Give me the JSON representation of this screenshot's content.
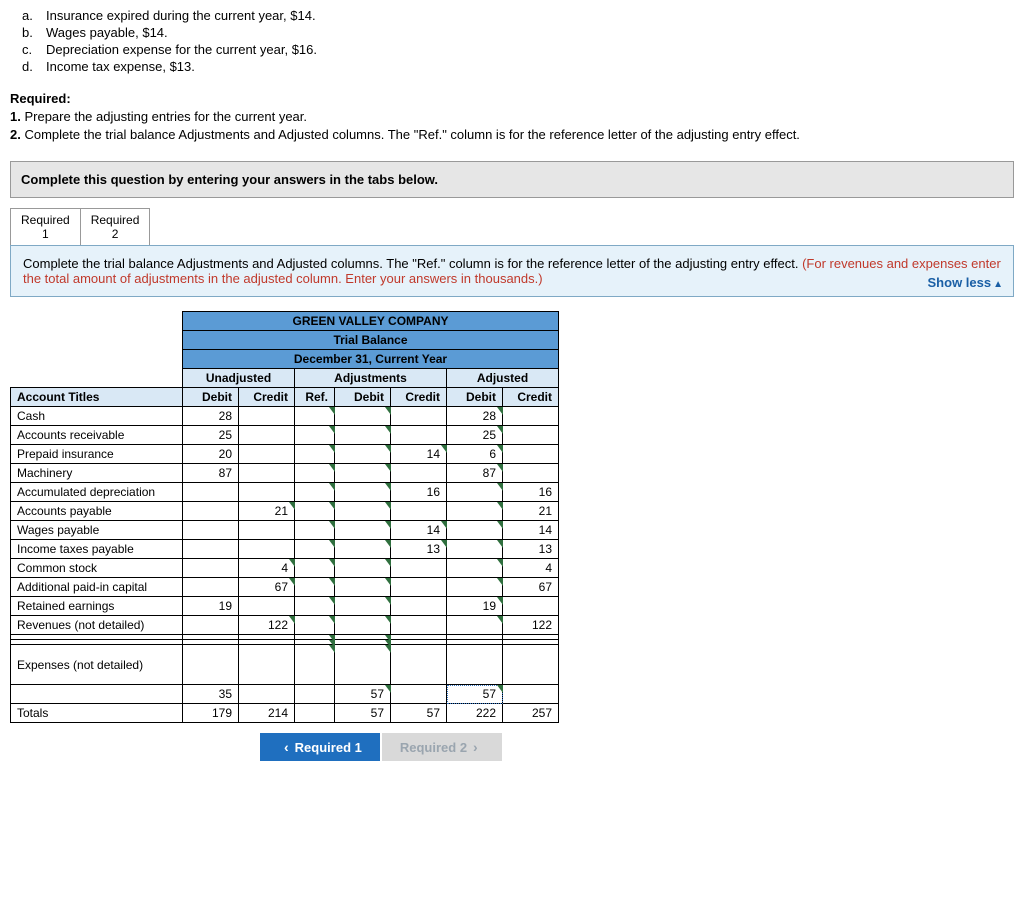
{
  "items": [
    {
      "letter": "a.",
      "text": "Insurance expired during the current year, $14."
    },
    {
      "letter": "b.",
      "text": "Wages payable, $14."
    },
    {
      "letter": "c.",
      "text": "Depreciation expense for the current year, $16."
    },
    {
      "letter": "d.",
      "text": "Income tax expense, $13."
    }
  ],
  "req_label": "Required:",
  "req": [
    {
      "n": "1.",
      "t": "Prepare the adjusting entries for the current year."
    },
    {
      "n": "2.",
      "t": "Complete the trial balance Adjustments and Adjusted columns. The \"Ref.\" column is for the reference letter of the adjusting entry effect."
    }
  ],
  "instr_bar": "Complete this question by entering your answers in the tabs below.",
  "tabs": [
    {
      "l1": "Required",
      "l2": "1"
    },
    {
      "l1": "Required",
      "l2": "2"
    }
  ],
  "prompt": {
    "main": "Complete the trial balance Adjustments and Adjusted columns. The \"Ref.\" column is for the reference letter of the adjusting entry effect. ",
    "red": "(For revenues and expenses enter the total amount of adjustments in the adjusted column. Enter your answers in thousands.)",
    "showless": "Show less"
  },
  "hdr": {
    "company": "GREEN VALLEY COMPANY",
    "title": "Trial Balance",
    "date": "December 31, Current Year",
    "unadj": "Unadjusted",
    "adjm": "Adjustments",
    "adj": "Adjusted",
    "acct": "Account Titles",
    "debit": "Debit",
    "credit": "Credit",
    "ref": "Ref."
  },
  "rows": [
    {
      "acct": "Cash",
      "ud": "28",
      "uc": "",
      "r": "",
      "ad": "",
      "ac": "",
      "jd": "28",
      "jc": ""
    },
    {
      "acct": "Accounts receivable",
      "ud": "25",
      "uc": "",
      "r": "",
      "ad": "",
      "ac": "",
      "jd": "25",
      "jc": ""
    },
    {
      "acct": "Prepaid insurance",
      "ud": "20",
      "uc": "",
      "r": "",
      "ad": "",
      "ac": "14",
      "jd": "6",
      "jc": "",
      "acflag": true
    },
    {
      "acct": "Machinery",
      "ud": "87",
      "uc": "",
      "r": "",
      "ad": "",
      "ac": "",
      "jd": "87",
      "jc": ""
    },
    {
      "acct": "Accumulated depreciation",
      "ud": "",
      "uc": "",
      "r": "",
      "ad": "",
      "ac": "16",
      "jd": "",
      "jc": "16"
    },
    {
      "acct": "Accounts payable",
      "ud": "",
      "uc": "21",
      "r": "",
      "ad": "",
      "ac": "",
      "jd": "",
      "jc": "21",
      "ucflag": true
    },
    {
      "acct": "Wages payable",
      "ud": "",
      "uc": "",
      "r": "",
      "ad": "",
      "ac": "14",
      "jd": "",
      "jc": "14",
      "acflag": true
    },
    {
      "acct": "Income taxes payable",
      "ud": "",
      "uc": "",
      "r": "",
      "ad": "",
      "ac": "13",
      "jd": "",
      "jc": "13",
      "acflag": true
    },
    {
      "acct": "Common stock",
      "ud": "",
      "uc": "4",
      "r": "",
      "ad": "",
      "ac": "",
      "jd": "",
      "jc": "4",
      "ucflag": true
    },
    {
      "acct": "Additional paid-in capital",
      "ud": "",
      "uc": "67",
      "r": "",
      "ad": "",
      "ac": "",
      "jd": "",
      "jc": "67",
      "ucflag": true
    },
    {
      "acct": "Retained earnings",
      "ud": "19",
      "uc": "",
      "r": "",
      "ad": "",
      "ac": "",
      "jd": "19",
      "jc": ""
    },
    {
      "acct": "Revenues (not detailed)",
      "ud": "",
      "uc": "122",
      "r": "",
      "ad": "",
      "ac": "",
      "jd": "",
      "jc": "122",
      "ucflag": true
    }
  ],
  "blank_rows": 2,
  "expenses": {
    "label": "Expenses (not detailed)"
  },
  "sumrow": {
    "acct": "",
    "ud": "35",
    "uc": "",
    "r": "",
    "ad": "57",
    "ac": "",
    "jd": "57",
    "jc": "",
    "adflag": true,
    "jdflag": true,
    "jddash": true
  },
  "totals": {
    "label": " Totals",
    "ud": "179",
    "uc": "214",
    "r": "",
    "ad": "57",
    "ac": "57",
    "jd": "222",
    "jc": "257"
  },
  "nav": {
    "prev": "Required 1",
    "next": "Required 2"
  }
}
